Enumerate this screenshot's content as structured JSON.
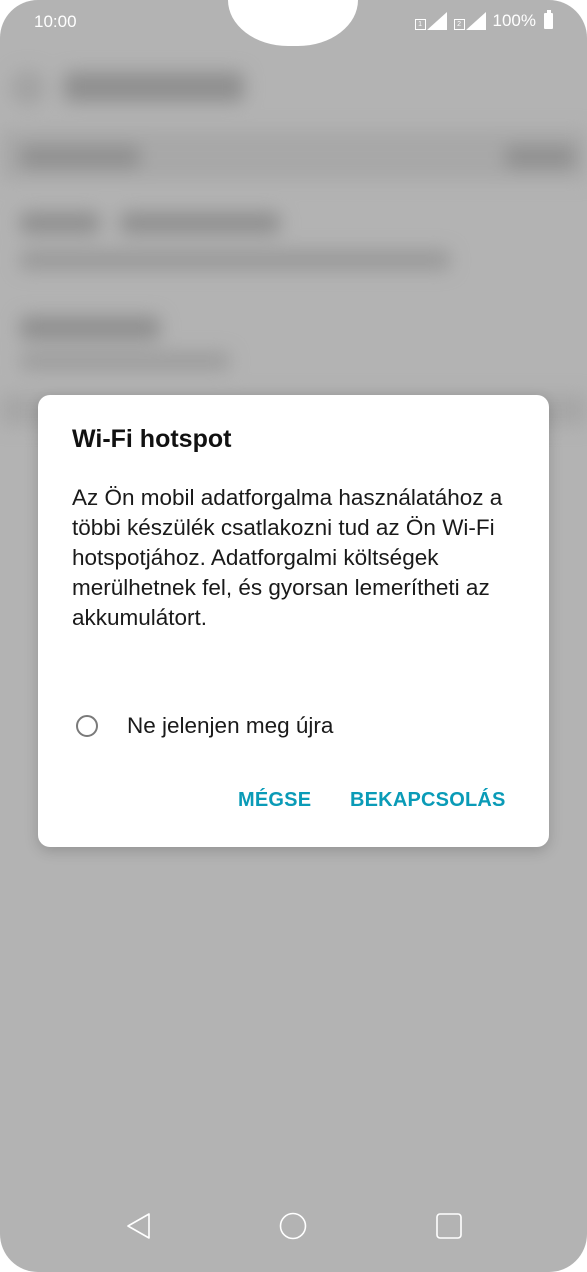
{
  "status_bar": {
    "time": "10:00",
    "sim1_tag": "1",
    "sim2_tag": "2",
    "battery": "100%"
  },
  "dialog": {
    "title": "Wi-Fi hotspot",
    "body": "Az Ön mobil adatforgalma használatához a többi készülék csatlakozni tud az Ön Wi-Fi hotspotjához. Adatforgalmi költségek merülhetnek fel, és gyorsan lemerítheti az akkumulátort.",
    "dont_show_again": {
      "label": "Ne jelenjen meg újra",
      "checked": false
    },
    "cancel_label": "MÉGSE",
    "confirm_label": "BEKAPCSOLÁS"
  },
  "nav_bar": {
    "icons": [
      "back-icon",
      "home-icon",
      "recents-icon"
    ]
  },
  "colors": {
    "accent": "#0a9bb7",
    "scrim": "#b3b3b3",
    "dialog_bg": "#ffffff"
  }
}
